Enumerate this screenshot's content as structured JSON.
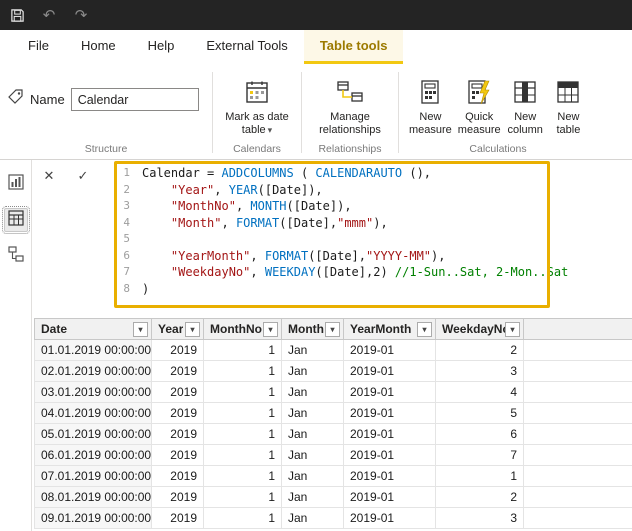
{
  "titlebar": {
    "save": "save",
    "undo": "↶",
    "redo": "↷"
  },
  "menu": {
    "tabs": [
      "File",
      "Home",
      "Help",
      "External Tools",
      "Table tools"
    ],
    "active_index": 4
  },
  "ribbon": {
    "name_label": "Name",
    "name_value": "Calendar",
    "buttons": {
      "mark_as_date_table": "Mark as date table",
      "manage_relationships": "Manage relationships",
      "new_measure": "New measure",
      "quick_measure": "Quick measure",
      "new_column": "New column",
      "new_table": "New table"
    },
    "groups": [
      "Structure",
      "Calendars",
      "Relationships",
      "Calculations"
    ]
  },
  "icons": {
    "chevron_down": "▾",
    "cancel": "✕",
    "commit": "✓"
  },
  "colors": {
    "accent_yellow": "#f2c811",
    "highlight_border": "#e9af00",
    "func_blue": "#0070c0",
    "string_red": "#a31515",
    "comment_green": "#008000"
  },
  "formula": {
    "lines": [
      {
        "num": 1,
        "tokens": [
          {
            "c": "plain",
            "t": "Calendar = "
          },
          {
            "c": "func",
            "t": "ADDCOLUMNS"
          },
          {
            "c": "plain",
            "t": " ( "
          },
          {
            "c": "func",
            "t": "CALENDARAUTO"
          },
          {
            "c": "plain",
            "t": " (),"
          }
        ]
      },
      {
        "num": 2,
        "tokens": [
          {
            "c": "plain",
            "t": "    "
          },
          {
            "c": "str",
            "t": "\"Year\""
          },
          {
            "c": "plain",
            "t": ", "
          },
          {
            "c": "func",
            "t": "YEAR"
          },
          {
            "c": "plain",
            "t": "([Date]),"
          }
        ]
      },
      {
        "num": 3,
        "tokens": [
          {
            "c": "plain",
            "t": "    "
          },
          {
            "c": "str",
            "t": "\"MonthNo\""
          },
          {
            "c": "plain",
            "t": ", "
          },
          {
            "c": "func",
            "t": "MONTH"
          },
          {
            "c": "plain",
            "t": "([Date]),"
          }
        ]
      },
      {
        "num": 4,
        "tokens": [
          {
            "c": "plain",
            "t": "    "
          },
          {
            "c": "str",
            "t": "\"Month\""
          },
          {
            "c": "plain",
            "t": ", "
          },
          {
            "c": "func",
            "t": "FORMAT"
          },
          {
            "c": "plain",
            "t": "([Date],"
          },
          {
            "c": "str",
            "t": "\"mmm\""
          },
          {
            "c": "plain",
            "t": "),"
          }
        ]
      },
      {
        "num": 5,
        "tokens": []
      },
      {
        "num": 6,
        "tokens": [
          {
            "c": "plain",
            "t": "    "
          },
          {
            "c": "str",
            "t": "\"YearMonth\""
          },
          {
            "c": "plain",
            "t": ", "
          },
          {
            "c": "func",
            "t": "FORMAT"
          },
          {
            "c": "plain",
            "t": "([Date],"
          },
          {
            "c": "str",
            "t": "\"YYYY-MM\""
          },
          {
            "c": "plain",
            "t": "),"
          }
        ]
      },
      {
        "num": 7,
        "tokens": [
          {
            "c": "plain",
            "t": "    "
          },
          {
            "c": "str",
            "t": "\"WeekdayNo\""
          },
          {
            "c": "plain",
            "t": ", "
          },
          {
            "c": "func",
            "t": "WEEKDAY"
          },
          {
            "c": "plain",
            "t": "([Date],2) "
          },
          {
            "c": "comment",
            "t": "//1-Sun..Sat, 2-Mon..Sat"
          }
        ]
      },
      {
        "num": 8,
        "tokens": [
          {
            "c": "plain",
            "t": ")"
          }
        ]
      }
    ]
  },
  "table": {
    "headers": [
      "Date",
      "Year",
      "MonthNo",
      "Month",
      "YearMonth",
      "WeekdayNo"
    ],
    "rows": [
      [
        "01.01.2019 00:00:00",
        "2019",
        "1",
        "Jan",
        "2019-01",
        "2"
      ],
      [
        "02.01.2019 00:00:00",
        "2019",
        "1",
        "Jan",
        "2019-01",
        "3"
      ],
      [
        "03.01.2019 00:00:00",
        "2019",
        "1",
        "Jan",
        "2019-01",
        "4"
      ],
      [
        "04.01.2019 00:00:00",
        "2019",
        "1",
        "Jan",
        "2019-01",
        "5"
      ],
      [
        "05.01.2019 00:00:00",
        "2019",
        "1",
        "Jan",
        "2019-01",
        "6"
      ],
      [
        "06.01.2019 00:00:00",
        "2019",
        "1",
        "Jan",
        "2019-01",
        "7"
      ],
      [
        "07.01.2019 00:00:00",
        "2019",
        "1",
        "Jan",
        "2019-01",
        "1"
      ],
      [
        "08.01.2019 00:00:00",
        "2019",
        "1",
        "Jan",
        "2019-01",
        "2"
      ],
      [
        "09.01.2019 00:00:00",
        "2019",
        "1",
        "Jan",
        "2019-01",
        "3"
      ]
    ]
  }
}
